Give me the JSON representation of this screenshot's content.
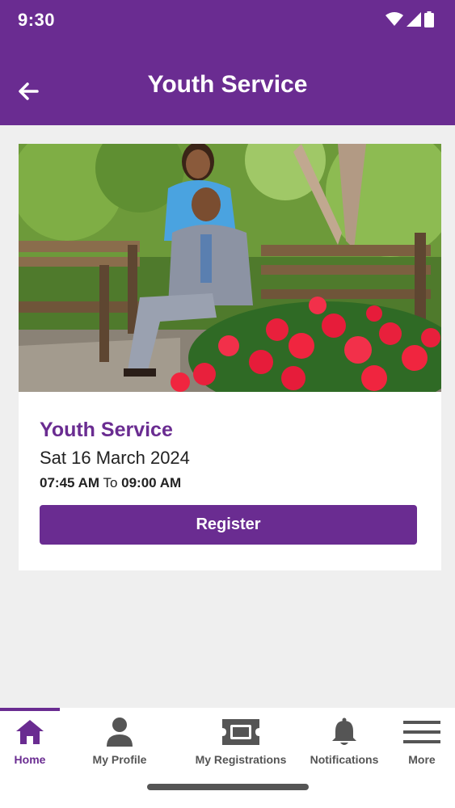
{
  "status_bar": {
    "time": "9:30"
  },
  "header": {
    "title": "Youth Service"
  },
  "event": {
    "image_alt": "Couple seated on a park bench among red flowers",
    "title": "Youth Service",
    "date": "Sat 16 March 2024",
    "start_time": "07:45 AM",
    "time_separator": "To",
    "end_time": "09:00 AM",
    "register_label": "Register"
  },
  "bottom_nav": {
    "items": [
      {
        "label": "Home",
        "icon": "home-icon",
        "active": true
      },
      {
        "label": "My Profile",
        "icon": "person-icon",
        "active": false
      },
      {
        "label": "My Registrations",
        "icon": "ticket-icon",
        "active": false
      },
      {
        "label": "Notifications",
        "icon": "bell-icon",
        "active": false
      },
      {
        "label": "More",
        "icon": "menu-icon",
        "active": false
      }
    ]
  },
  "colors": {
    "primary": "#6a2c91",
    "background": "#efefef"
  }
}
